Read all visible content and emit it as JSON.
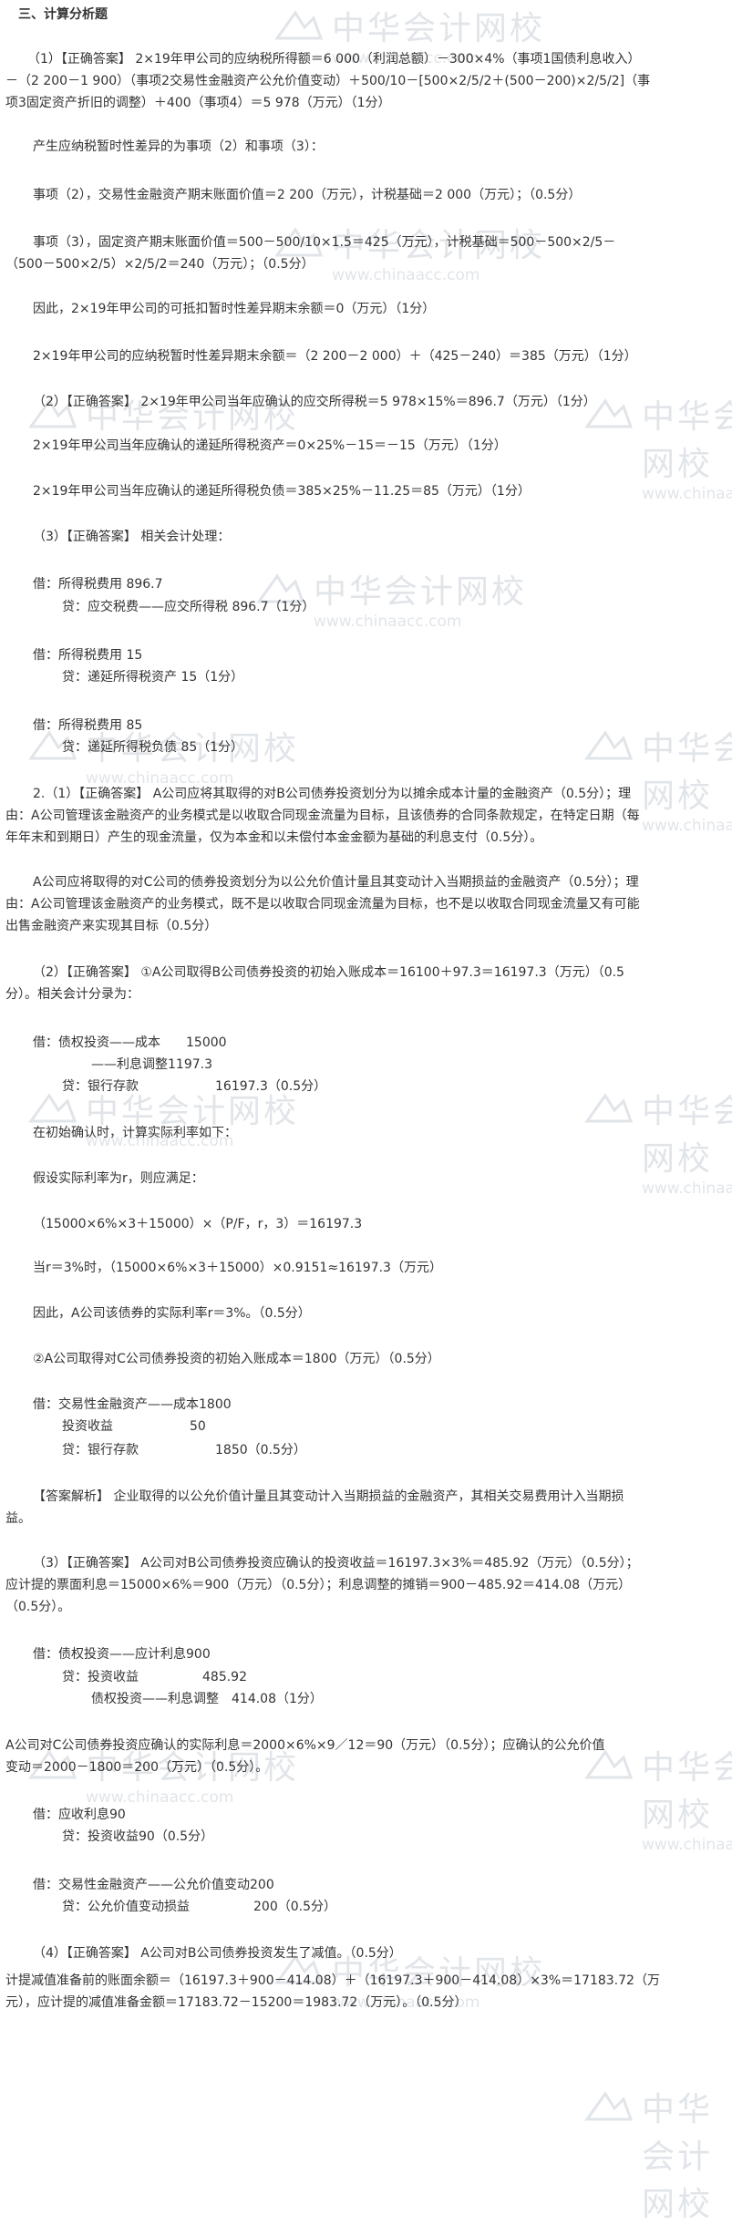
{
  "watermark": {
    "brand": "中华会计网校",
    "url": "www.chinaacc.com"
  },
  "lines": [
    {
      "id": "h3",
      "text": "三、计算分析题"
    },
    {
      "id": "l1",
      "text": "（1）【正确答案】 2×19年甲公司的应纳税所得额＝6 000（利润总额）－300×4%（事项1国债利息收入）"
    },
    {
      "id": "l2",
      "text": "－（2 200－1 900）（事项2交易性金融资产公允价值变动）＋500/10－[500×2/5/2＋(500－200)×2/5/2]（事"
    },
    {
      "id": "l3",
      "text": "项3固定资产折旧的调整）＋400（事项4）＝5 978（万元）（1分）"
    },
    {
      "id": "l4",
      "text": "产生应纳税暂时性差异的为事项（2）和事项（3）："
    },
    {
      "id": "l5",
      "text": "事项（2），交易性金融资产期末账面价值＝2 200（万元），计税基础＝2 000（万元）；（0.5分）"
    },
    {
      "id": "l6",
      "text": "事项（3），固定资产期末账面价值＝500－500/10×1.5＝425（万元），计税基础＝500－500×2/5－"
    },
    {
      "id": "l7",
      "text": "（500－500×2/5）×2/5/2＝240（万元）；（0.5分）"
    },
    {
      "id": "l8",
      "text": "因此，2×19年甲公司的可抵扣暂时性差异期末余额＝0（万元）（1分）"
    },
    {
      "id": "l9",
      "text": "2×19年甲公司的应纳税暂时性差异期末余额＝（2 200－2 000）＋（425－240）＝385（万元）（1分）"
    },
    {
      "id": "l10",
      "text": "（2）【正确答案】 2×19年甲公司当年应确认的应交所得税＝5 978×15%＝896.7（万元）（1分）"
    },
    {
      "id": "l11",
      "text": "2×19年甲公司当年应确认的递延所得税资产＝0×25%－15＝－15（万元）（1分）"
    },
    {
      "id": "l12",
      "text": "2×19年甲公司当年应确认的递延所得税负债＝385×25%－11.25＝85（万元）（1分）"
    },
    {
      "id": "l13",
      "text": "（3）【正确答案】 相关会计处理："
    },
    {
      "id": "l14",
      "text": "借：所得税费用 896.7"
    },
    {
      "id": "l15",
      "text": "贷：应交税费——应交所得税 896.7（1分）"
    },
    {
      "id": "l16",
      "text": "借：所得税费用 15"
    },
    {
      "id": "l17",
      "text": "贷：递延所得税资产 15（1分）"
    },
    {
      "id": "l18",
      "text": "借：所得税费用 85"
    },
    {
      "id": "l19",
      "text": "贷：递延所得税负债 85（1分）"
    },
    {
      "id": "l20",
      "text": "2.（1）【正确答案】 A公司应将其取得的对B公司债券投资划分为以摊余成本计量的金融资产（0.5分）；理"
    },
    {
      "id": "l21",
      "text": "由：A公司管理该金融资产的业务模式是以收取合同现金流量为目标，且该债券的合同条款规定，在特定日期（每"
    },
    {
      "id": "l22",
      "text": "年年末和到期日）产生的现金流量，仅为本金和以未偿付本金金额为基础的利息支付（0.5分）。"
    },
    {
      "id": "l23",
      "text": "A公司应将取得的对C公司的债券投资划分为以公允价值计量且其变动计入当期损益的金融资产（0.5分）；理"
    },
    {
      "id": "l24",
      "text": "由：A公司管理该金融资产的业务模式，既不是以收取合同现金流量为目标，也不是以收取合同现金流量又有可能"
    },
    {
      "id": "l25",
      "text": "出售金融资产来实现其目标（0.5分）"
    },
    {
      "id": "l26",
      "text": "（2）【正确答案】 ①A公司取得B公司债券投资的初始入账成本＝16100＋97.3＝16197.3（万元）（0.5"
    },
    {
      "id": "l27",
      "text": "分）。相关会计分录为："
    },
    {
      "id": "l28",
      "text": "借：债权投资——成本　　15000"
    },
    {
      "id": "l29",
      "text": "——利息调整1197.3"
    },
    {
      "id": "l30",
      "text": "贷：银行存款　　　　　　16197.3（0.5分）"
    },
    {
      "id": "l31",
      "text": "在初始确认时，计算实际利率如下："
    },
    {
      "id": "l32",
      "text": "假设实际利率为r，则应满足："
    },
    {
      "id": "l33",
      "text": "（15000×6%×3＋15000）×（P/F，r，3）＝16197.3"
    },
    {
      "id": "l34",
      "text": "当r＝3%时，（15000×6%×3＋15000）×0.9151≈16197.3（万元）"
    },
    {
      "id": "l35",
      "text": "因此，A公司该债券的实际利率r＝3%。（0.5分）"
    },
    {
      "id": "l36",
      "text": "②A公司取得对C公司债券投资的初始入账成本＝1800（万元）（0.5分）"
    },
    {
      "id": "l37",
      "text": "借：交易性金融资产——成本1800"
    },
    {
      "id": "l38",
      "text": "投资收益　　　　　　50"
    },
    {
      "id": "l39",
      "text": "贷：银行存款　　　　　　1850（0.5分）"
    },
    {
      "id": "l40",
      "text": "【答案解析】 企业取得的以公允价值计量且其变动计入当期损益的金融资产，其相关交易费用计入当期损"
    },
    {
      "id": "l41",
      "text": "益。"
    },
    {
      "id": "l42",
      "text": "（3）【正确答案】 A公司对B公司债券投资应确认的投资收益＝16197.3×3%＝485.92（万元）（0.5分）；"
    },
    {
      "id": "l43",
      "text": "应计提的票面利息＝15000×6%＝900（万元）（0.5分）；利息调整的摊销＝900－485.92＝414.08（万元）"
    },
    {
      "id": "l44",
      "text": "（0.5分）。"
    },
    {
      "id": "l45",
      "text": "借：债权投资——应计利息900"
    },
    {
      "id": "l46",
      "text": "贷：投资收益　　　　　485.92"
    },
    {
      "id": "l47",
      "text": "债权投资——利息调整　414.08（1分）"
    },
    {
      "id": "l48",
      "text": "A公司对C公司债券投资应确认的实际利息＝2000×6%×9／12＝90（万元）（0.5分）；应确认的公允价值"
    },
    {
      "id": "l49",
      "text": "变动＝2000－1800＝200（万元）（0.5分）。"
    },
    {
      "id": "l50",
      "text": "借：应收利息90"
    },
    {
      "id": "l51",
      "text": "贷：投资收益90（0.5分）"
    },
    {
      "id": "l52",
      "text": "借：交易性金融资产——公允价值变动200"
    },
    {
      "id": "l53",
      "text": "贷：公允价值变动损益　　　　　200（0.5分）"
    },
    {
      "id": "l54",
      "text": "（4）【正确答案】 A公司对B公司债券投资发生了减值。（0.5分）"
    },
    {
      "id": "l55",
      "text": "计提减值准备前的账面余额＝（16197.3＋900－414.08）＋（16197.3＋900－414.08）×3%＝17183.72（万"
    },
    {
      "id": "l56",
      "text": "元），应计提的减值准备金额＝17183.72－15200＝1983.72（万元）。（0.5分）"
    }
  ]
}
